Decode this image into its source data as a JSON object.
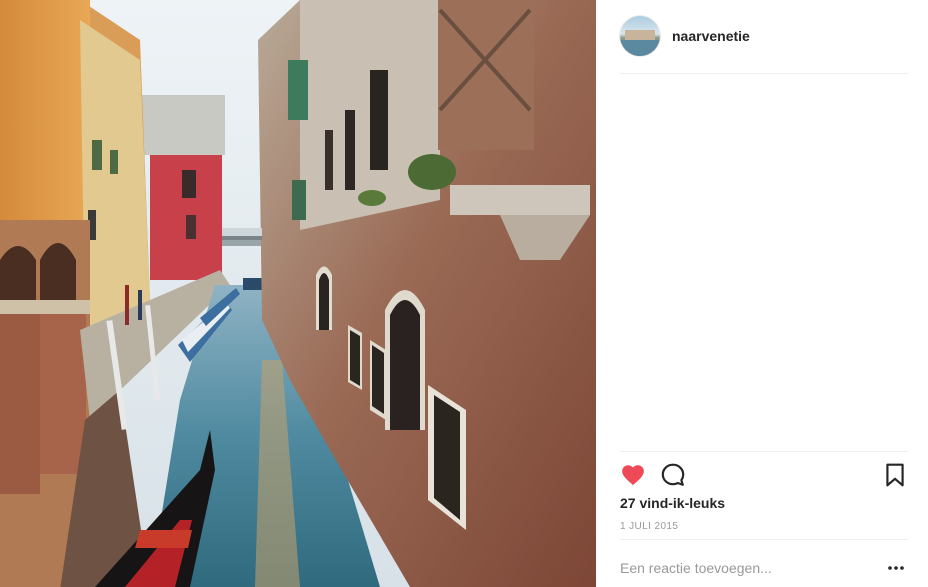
{
  "post": {
    "username": "naarvenetie",
    "likes_text": "27 vind-ik-leuks",
    "date_text": "1 JULI 2015",
    "liked": true
  },
  "comment": {
    "placeholder": "Een reactie toevoegen..."
  },
  "icons": {
    "like": "heart-icon",
    "comment": "comment-bubble-icon",
    "save": "bookmark-icon",
    "more": "more-options-icon"
  },
  "colors": {
    "like_active": "#ed4956",
    "text_primary": "#262626",
    "text_secondary": "#999999",
    "divider": "#efefef"
  }
}
